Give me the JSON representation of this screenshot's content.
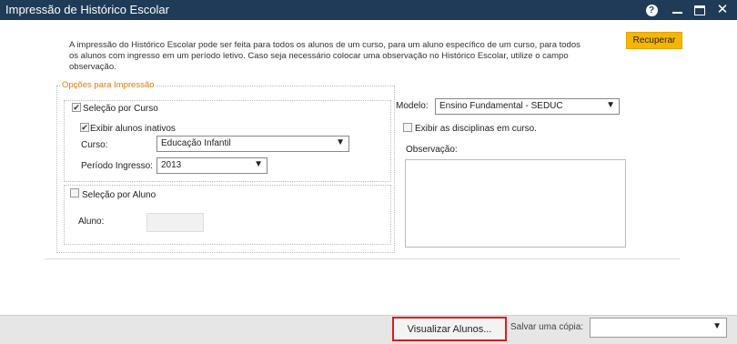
{
  "window": {
    "title": "Impressão de Histórico Escolar",
    "help_glyph": "?",
    "close_glyph": "✕"
  },
  "intro_text": "A impressão do Histórico Escolar pode ser feita para todos os alunos de um curso, para um aluno específico de um curso, para todos os alunos com ingresso em um período letivo. Caso seja necessário colocar uma observação no Histórico Escolar, utilize o campo observação.",
  "buttons": {
    "recuperar": "Recuperar",
    "visualizar": "Visualizar Alunos..."
  },
  "options": {
    "legend": "Opções para Impressão",
    "selecao_curso": {
      "label": "Seleção por Curso",
      "checked": true
    },
    "exibir_inativos": {
      "label": "Exibir alunos inativos",
      "checked": true
    },
    "curso": {
      "label": "Curso:",
      "value": "Educação Infantil"
    },
    "periodo": {
      "label": "Período Ingresso:",
      "value": "2013"
    },
    "selecao_aluno": {
      "label": "Seleção por Aluno",
      "checked": false
    },
    "aluno": {
      "label": "Aluno:",
      "value": ""
    }
  },
  "right_panel": {
    "modelo": {
      "label": "Modelo:",
      "value": "Ensino Fundamental - SEDUC"
    },
    "exibir_disciplinas": {
      "label": "Exibir as disciplinas em curso.",
      "checked": false
    },
    "observacao": {
      "label": "Observação:",
      "value": ""
    }
  },
  "footer": {
    "copy_label": "Salvar uma cópia:",
    "copy_value": ""
  },
  "glyphs": {
    "check": "✔",
    "dropdown": "▼"
  },
  "colors": {
    "titlebar": "#1f3b57",
    "accent_button": "#f7b500",
    "legend": "#e8770b",
    "highlight": "#e01b1b"
  }
}
